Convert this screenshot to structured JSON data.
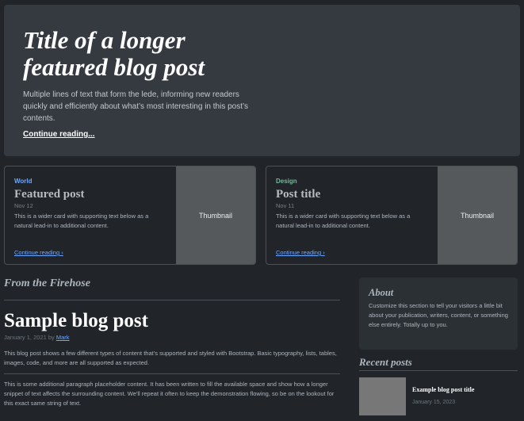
{
  "hero": {
    "title": "Title of a longer featured blog post",
    "lede": "Multiple lines of text that form the lede, informing new readers quickly and efficiently about what’s most interesting in this post’s contents.",
    "link": "Continue reading..."
  },
  "cards": [
    {
      "category": "World",
      "category_color": "#6ea8fe",
      "title": "Featured post",
      "date": "Nov 12",
      "text": "This is a wider card with supporting text below as a natural lead-in to additional content.",
      "link": "Continue reading",
      "thumbnail": "Thumbnail"
    },
    {
      "category": "Design",
      "category_color": "#75b798",
      "title": "Post title",
      "date": "Nov 11",
      "text": "This is a wider card with supporting text below as a natural lead-in to additional content.",
      "link": "Continue reading",
      "thumbnail": "Thumbnail"
    }
  ],
  "main": {
    "section_title": "From the Firehose",
    "post": {
      "title": "Sample blog post",
      "date": "January 1, 2021 by",
      "author": "Mark",
      "p1": "This blog post shows a few different types of content that’s supported and styled with Bootstrap. Basic typography, lists, tables, images, code, and more are all supported as expected.",
      "p2": "This is some additional paragraph placeholder content. It has been written to fill the available space and show how a longer snippet of text affects the surrounding content. We'll repeat it often to keep the demonstration flowing, so be on the lookout for this exact same string of text."
    }
  },
  "sidebar": {
    "about_title": "About",
    "about_text": "Customize this section to tell your visitors a little bit about your publication, writers, content, or something else entirely. Totally up to you.",
    "recent_title": "Recent posts",
    "recent": [
      {
        "title": "Example blog post title",
        "date": "January 15, 2023"
      }
    ]
  }
}
